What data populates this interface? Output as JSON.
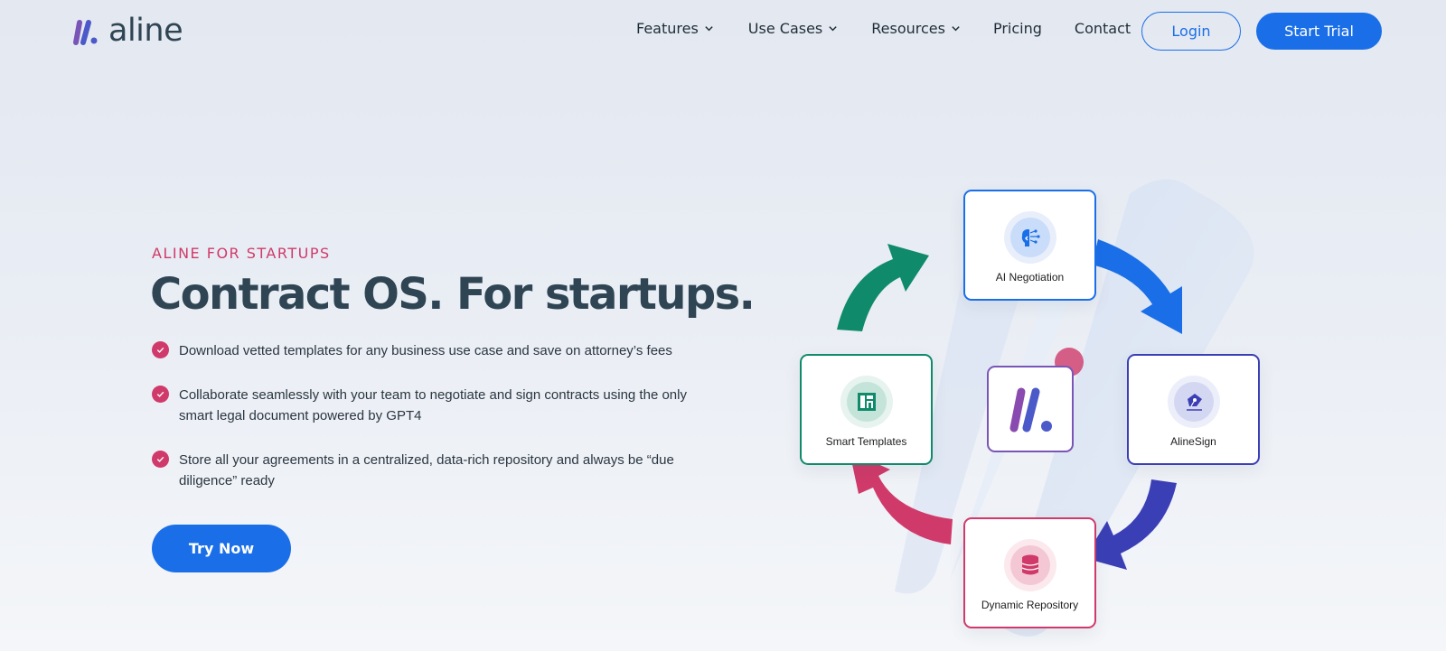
{
  "brand": {
    "name": "aline"
  },
  "nav": {
    "items": [
      {
        "label": "Features",
        "has_dropdown": true
      },
      {
        "label": "Use Cases",
        "has_dropdown": true
      },
      {
        "label": "Resources",
        "has_dropdown": true
      },
      {
        "label": "Pricing",
        "has_dropdown": false
      },
      {
        "label": "Contact",
        "has_dropdown": false
      }
    ],
    "login_label": "Login",
    "trial_label": "Start Trial"
  },
  "hero": {
    "eyebrow": "ALINE FOR STARTUPS",
    "title": "Contract OS. For startups.",
    "bullets": [
      "Download vetted templates for any business use case and save on attorney’s fees",
      "Collaborate seamlessly with your team to negotiate and sign contracts using the only smart legal document powered by GPT4",
      "Store all your agreements in a centralized, data-rich repository and always be “due diligence” ready"
    ],
    "cta_label": "Try Now"
  },
  "diagram": {
    "cards": {
      "top": {
        "label": "AI Negotiation",
        "icon": "ai-brain-icon",
        "color": "#1a6fe8"
      },
      "right": {
        "label": "AlineSign",
        "icon": "pen-nib-icon",
        "color": "#3b3fb5"
      },
      "bottom": {
        "label": "Dynamic Repository",
        "icon": "database-icon",
        "color": "#d03a6a"
      },
      "left": {
        "label": "Smart Templates",
        "icon": "template-layout-icon",
        "color": "#0f8a6a"
      }
    },
    "center_icon": "aline-logo-icon"
  },
  "colors": {
    "primary": "#1a6fe8",
    "accent_pink": "#d03a6a",
    "heading": "#2f4553",
    "green": "#0f8a6a",
    "indigo": "#3b3fb5"
  }
}
